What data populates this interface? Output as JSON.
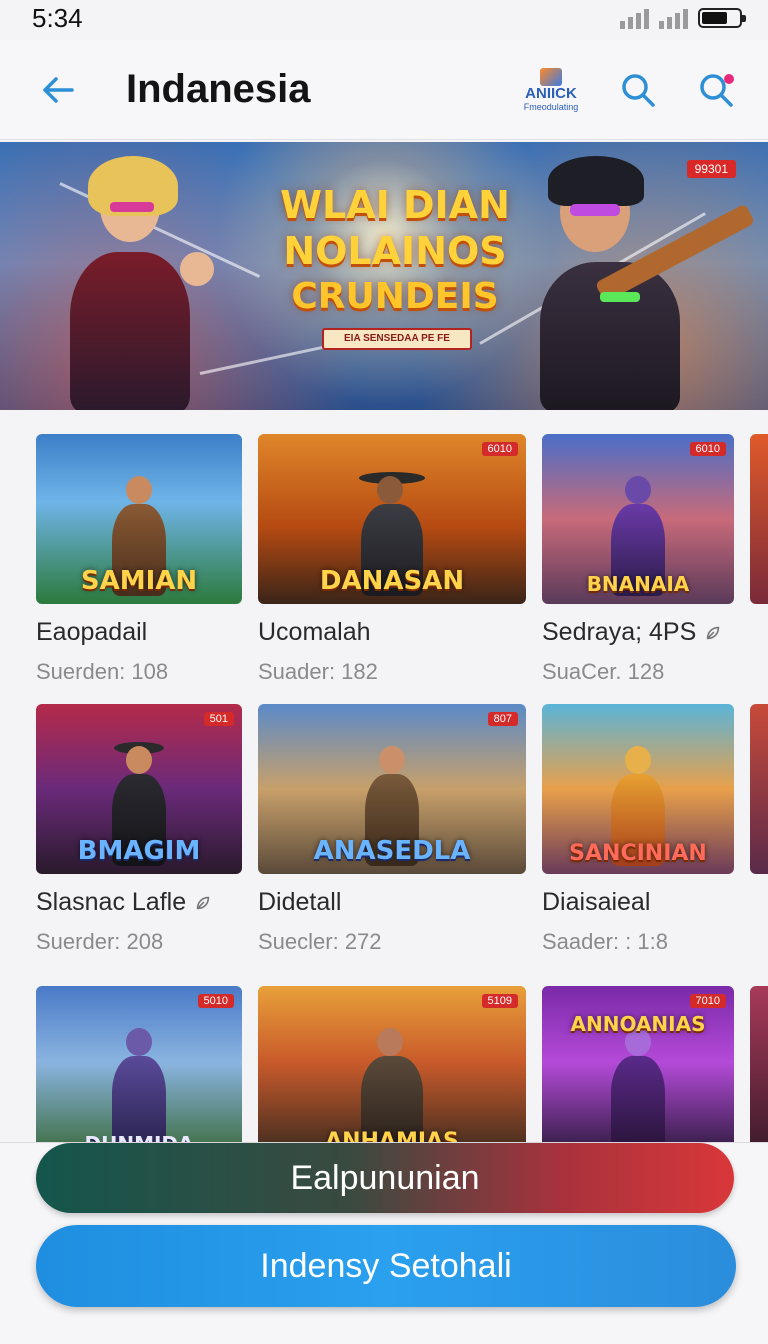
{
  "status_bar": {
    "time": "5:34"
  },
  "header": {
    "title": "Indanesia",
    "brand_name": "ANIICK",
    "brand_sub": "Fmeodulating"
  },
  "banner": {
    "title_line1": "WLAI DIAN",
    "title_line2": "NOLAINOS",
    "title_line3": "CRUNDEIS",
    "ribbon": "EIA SENSEDAA PE FE",
    "badge": "99301"
  },
  "games": [
    {
      "thumb_title": "SAMIAN",
      "badge": "",
      "name": "Eaopadail",
      "stat": "Suerden: 108",
      "icon": ""
    },
    {
      "thumb_title": "DANASAN",
      "badge": "6010",
      "name": "Ucomalah",
      "stat": "Suader: 182",
      "icon": ""
    },
    {
      "thumb_title": "BNANAIA",
      "badge": "6010",
      "name": "Sedraya; 4PS",
      "stat": "SuaCer. 128",
      "icon": "leaf-icon"
    },
    {
      "thumb_title": "BMAGIM",
      "badge": "501",
      "name": "Slasnac Lafle",
      "stat": "Suerder: 208",
      "icon": "leaf-icon"
    },
    {
      "thumb_title": "ANASEDLA",
      "badge": "807",
      "name": "Didetall",
      "stat": "Suecler: 272",
      "icon": ""
    },
    {
      "thumb_title": "SANCINIAN",
      "badge": "",
      "name": "Diaisaieal",
      "stat": "Saader: : 1:8",
      "icon": ""
    },
    {
      "thumb_title": "DUNMIDA",
      "badge": "5010",
      "name": "",
      "stat": "",
      "icon": ""
    },
    {
      "thumb_title": "ANHAMIAS",
      "badge": "5109",
      "name": "",
      "stat": "",
      "icon": ""
    },
    {
      "thumb_title": "ANNOANIAS",
      "badge": "7010",
      "name": "",
      "stat": "",
      "icon": ""
    }
  ],
  "buttons": {
    "primary": "Ealpununian",
    "secondary": "Indensy Setohali"
  }
}
